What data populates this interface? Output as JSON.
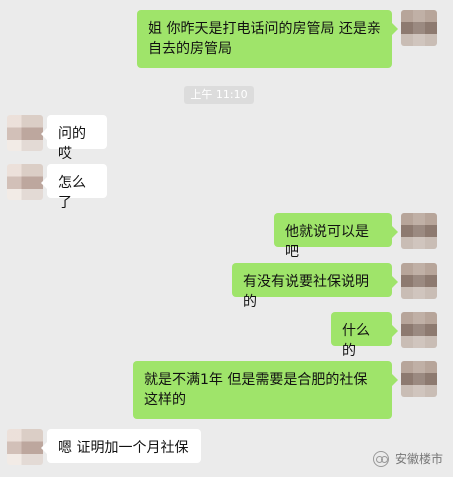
{
  "time_label": "上午 11:10",
  "messages": [
    {
      "side": "right",
      "text": "姐  你昨天是打电话问的房管局 还是亲自去的房管局"
    },
    {
      "side": "left",
      "text": "问的哎"
    },
    {
      "side": "left",
      "text": "怎么了"
    },
    {
      "side": "right",
      "text": "他就说可以是吧"
    },
    {
      "side": "right",
      "text": "有没有说要社保说明的"
    },
    {
      "side": "right",
      "text": "什么的"
    },
    {
      "side": "right",
      "text": "就是不满1年  但是需要是合肥的社保这样的"
    },
    {
      "side": "left",
      "text": "嗯  证明加一个月社保"
    }
  ],
  "watermark": {
    "text": "安徽楼市",
    "icon": "wechat-icon"
  },
  "colors": {
    "background": "#ebebeb",
    "right_bubble": "#9fe46a",
    "left_bubble": "#ffffff"
  }
}
